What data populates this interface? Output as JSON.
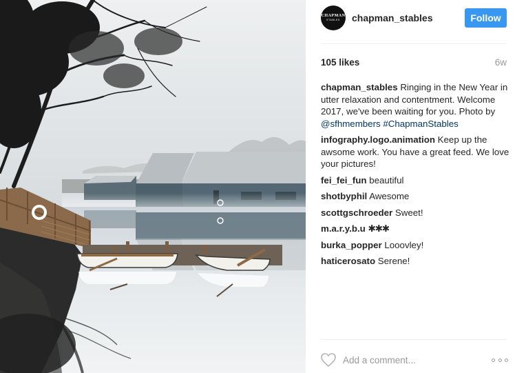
{
  "photo": {
    "alt_icon": "lake-boathouse-photo"
  },
  "header": {
    "avatar_line1": "CHAPMAN",
    "avatar_line2": "STABLES",
    "username": "chapman_stables",
    "follow_label": "Follow"
  },
  "stats": {
    "likes": "105 likes",
    "time": "6w"
  },
  "caption": {
    "user": "chapman_stables",
    "text": "Ringing in the New Year in utter relaxation and contentment. Welcome 2017, we've been waiting for you. Photo by ",
    "mention": "@sfhmembers",
    "hashtag": "#ChapmanStables"
  },
  "comments": [
    {
      "user": "infography.logo.animation",
      "text": "Keep up the awsome work. You have a great feed. We love your pictures!"
    },
    {
      "user": "fei_fei_fun",
      "text": "beautiful"
    },
    {
      "user": "shotbyphil",
      "text": "Awesome"
    },
    {
      "user": "scottgschroeder",
      "text": "Sweet!"
    },
    {
      "user": "m.a.r.y.b.u",
      "text": "✱✱✱"
    },
    {
      "user": "burka_popper",
      "text": "Looovley!"
    },
    {
      "user": "haticerosato",
      "text": "Serene!"
    }
  ],
  "footer": {
    "placeholder": "Add a comment...",
    "like_icon": "heart-icon",
    "more_icon": "more-options-icon"
  },
  "colors": {
    "follow": "#3897f0",
    "link": "#003569",
    "muted": "#999999",
    "divider": "#efefef"
  }
}
